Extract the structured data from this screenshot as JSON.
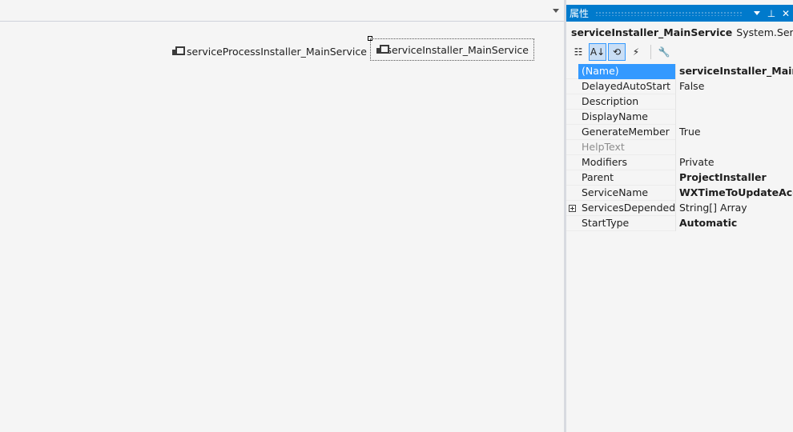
{
  "designer": {
    "components": [
      {
        "label": "serviceProcessInstaller_MainService"
      },
      {
        "label": "serviceInstaller_MainService"
      }
    ]
  },
  "properties_panel": {
    "title": "属性",
    "title_icons": {
      "dropdown": "chevron-down-icon",
      "pin": "pin-icon",
      "close": "close-icon"
    },
    "pin_glyph": "⊥",
    "close_glyph": "✕",
    "object": {
      "name": "serviceInstaller_MainService",
      "type": "System.Service"
    },
    "toolbar": {
      "categorized_glyph": "☷",
      "alphabetical_glyph": "A↓",
      "properties_glyph": "⟲",
      "events_glyph": "⚡",
      "pages_glyph": "🔧"
    },
    "accent_color": "#007acc",
    "selection_color": "#3399ff",
    "rows": [
      {
        "name": "(Name)",
        "value": "serviceInstaller_MainService"
      },
      {
        "name": "DelayedAutoStart",
        "value": "False"
      },
      {
        "name": "Description",
        "value": ""
      },
      {
        "name": "DisplayName",
        "value": ""
      },
      {
        "name": "GenerateMember",
        "value": "True"
      },
      {
        "name": "HelpText",
        "value": ""
      },
      {
        "name": "Modifiers",
        "value": "Private"
      },
      {
        "name": "Parent",
        "value": "ProjectInstaller"
      },
      {
        "name": "ServiceName",
        "value": "WXTimeToUpdateAccessToken"
      },
      {
        "name": "ServicesDependedOn",
        "value": "String[] Array"
      },
      {
        "name": "StartType",
        "value": "Automatic"
      }
    ]
  }
}
